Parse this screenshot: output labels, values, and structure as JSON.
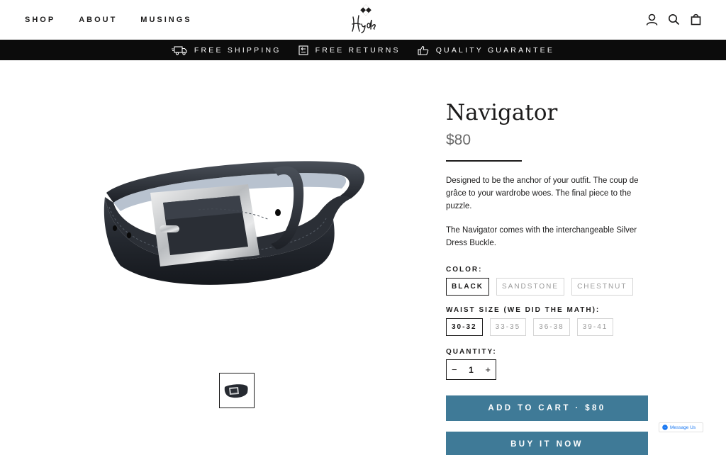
{
  "header": {
    "nav": [
      "SHOP",
      "ABOUT",
      "MUSINGS"
    ],
    "logo_text": "Hyde",
    "icons": [
      "account-icon",
      "search-icon",
      "cart-icon"
    ]
  },
  "promo": {
    "items": [
      {
        "icon": "truck-icon",
        "label": "FREE SHIPPING"
      },
      {
        "icon": "returns-icon",
        "label": "FREE RETURNS"
      },
      {
        "icon": "thumbs-up-icon",
        "label": "QUALITY GUARANTEE"
      }
    ]
  },
  "product": {
    "title": "Navigator",
    "price": "$80",
    "description": [
      "Designed to be the anchor of your outfit. The coup de grâce to your wardrobe woes. The final piece to the puzzle.",
      "The Navigator comes with the interchangeable Silver Dress Buckle."
    ],
    "color_label": "COLOR:",
    "colors": [
      {
        "label": "BLACK",
        "selected": true
      },
      {
        "label": "SANDSTONE",
        "selected": false
      },
      {
        "label": "CHESTNUT",
        "selected": false
      }
    ],
    "size_label": "WAIST SIZE (WE DID THE MATH):",
    "sizes": [
      {
        "label": "30-32",
        "selected": true
      },
      {
        "label": "33-35",
        "selected": false
      },
      {
        "label": "36-38",
        "selected": false
      },
      {
        "label": "39-41",
        "selected": false
      }
    ],
    "quantity_label": "QUANTITY:",
    "quantity": "1",
    "qty_minus": "−",
    "qty_plus": "+",
    "add_to_cart": "ADD TO CART · $80",
    "buy_now": "BUY IT NOW"
  },
  "messenger": {
    "label": "Message Us"
  },
  "colors": {
    "accent": "#3f7a97",
    "promo_bg": "#0c0c0c",
    "text": "#1c1b1b"
  }
}
